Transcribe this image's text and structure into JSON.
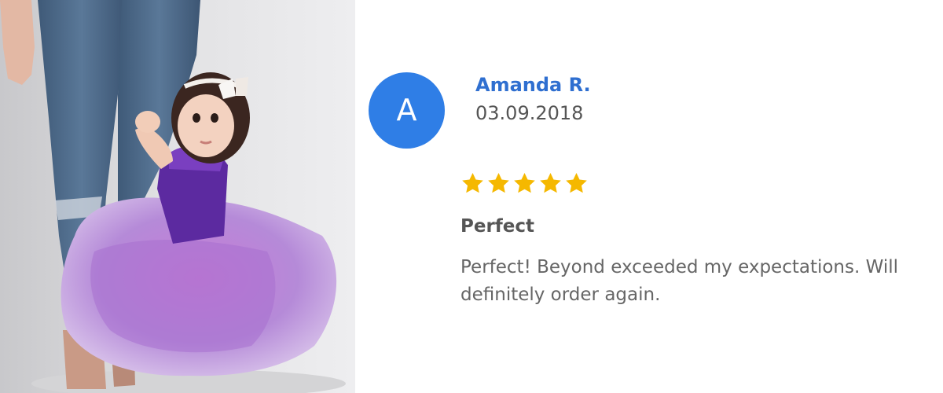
{
  "review": {
    "avatar_initial": "A",
    "reviewer_name": "Amanda R.",
    "date": "03.09.2018",
    "rating": 5,
    "rating_max": 5,
    "star_color": "#f5b800",
    "title": "Perfect",
    "body": "Perfect! Beyond exceeded my expectations. Will definitely order again."
  },
  "colors": {
    "avatar_bg": "#2f7ee6",
    "name_color": "#2f6fd0",
    "text_color": "#555555"
  }
}
